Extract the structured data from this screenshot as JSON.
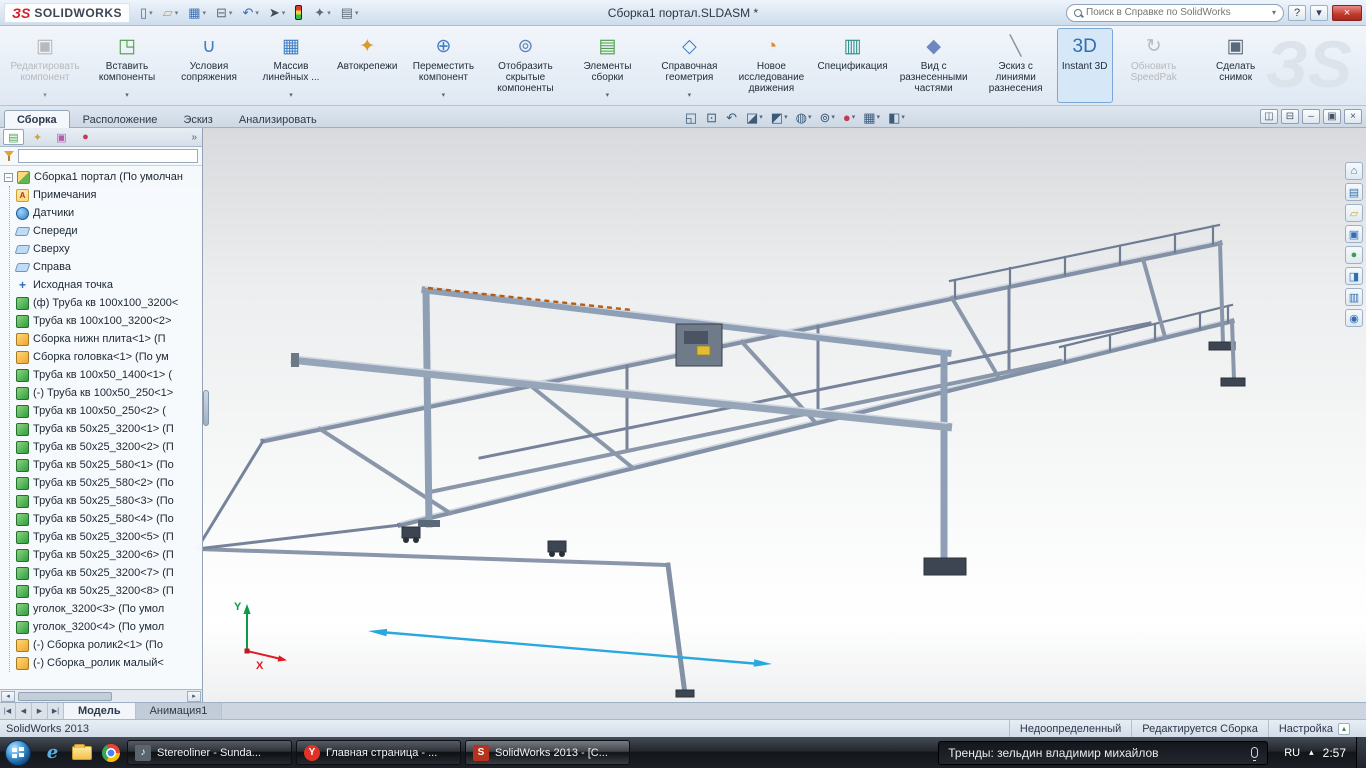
{
  "titlebar": {
    "logo_mark": "ЗS",
    "logo_text": "SOLIDWORKS",
    "title": "Сборка1 портал.SLDASM *",
    "search": {
      "placeholder": "Поиск в Справке по SolidWorks",
      "arrow": "▾"
    },
    "help": "?",
    "dropdown": "▾",
    "close": "×",
    "menu_icons": [
      {
        "name": "new-file-icon",
        "glyph": "▯",
        "color": "#5b6a7a",
        "arrow": "▾"
      },
      {
        "name": "open-icon",
        "glyph": "▱",
        "color": "#caa53d",
        "arrow": "▾"
      },
      {
        "name": "save-icon",
        "glyph": "▦",
        "color": "#3f6fb0",
        "arrow": "▾"
      },
      {
        "name": "print-icon",
        "glyph": "⊟",
        "color": "#5b6a7a",
        "arrow": "▾"
      },
      {
        "name": "undo-icon",
        "glyph": "↶",
        "color": "#2f6fb2",
        "arrow": "▾"
      },
      {
        "name": "select-icon",
        "glyph": "➤",
        "color": "#444c57",
        "arrow": "▾"
      },
      {
        "name": "rebuild-icon",
        "glyph": "",
        "color": "",
        "cls": "traffic-light",
        "arrow": ""
      },
      {
        "name": "options-icon",
        "glyph": "✦",
        "color": "#5b6a7a",
        "arrow": "▾"
      },
      {
        "name": "file-properties-icon",
        "glyph": "▤",
        "color": "#5b6a7a",
        "arrow": "▾"
      }
    ]
  },
  "ribbon": {
    "watermark": "ЗS",
    "buttons": [
      {
        "name": "edit-component-button",
        "label": "Редактировать компонент",
        "glyph": "▣",
        "color": "#9aa4ae",
        "arrow": "▾",
        "disabled": true
      },
      {
        "name": "insert-components-button",
        "label": "Вставить компоненты",
        "glyph": "◳",
        "color": "#4d9e46",
        "arrow": "▾"
      },
      {
        "name": "mates-button",
        "label": "Условия сопряжения",
        "glyph": "∪",
        "color": "#3f7fc4",
        "arrow": ""
      },
      {
        "name": "linear-pattern-button",
        "label": "Массив линейных ...",
        "glyph": "▦",
        "color": "#3f7fc4",
        "arrow": "▾"
      },
      {
        "name": "smart-fasteners-button",
        "label": "Автокрепежи",
        "glyph": "✦",
        "color": "#d99a2b",
        "arrow": ""
      },
      {
        "name": "move-component-button",
        "label": "Переместить компонент",
        "glyph": "⊕",
        "color": "#3f7fc4",
        "arrow": "▾"
      },
      {
        "name": "show-hidden-components-button",
        "label": "Отобразить скрытые компоненты",
        "glyph": "⊚",
        "color": "#5b86b8",
        "arrow": ""
      },
      {
        "name": "assembly-features-button",
        "label": "Элементы сборки",
        "glyph": "▤",
        "color": "#4d9e46",
        "arrow": "▾"
      },
      {
        "name": "reference-geometry-button",
        "label": "Справочная геометрия",
        "glyph": "◇",
        "color": "#3f7fc4",
        "arrow": "▾"
      },
      {
        "name": "new-motion-study-button",
        "label": "Новое исследование движения",
        "glyph": "◔",
        "color": "#e08a28",
        "arrow": ""
      },
      {
        "name": "bom-button",
        "label": "Спецификация",
        "glyph": "▥",
        "color": "#2e8f8a",
        "arrow": ""
      },
      {
        "name": "exploded-view-button",
        "label": "Вид с разнесенными частями",
        "glyph": "◆",
        "color": "#6d87c0",
        "arrow": ""
      },
      {
        "name": "explode-line-sketch-button",
        "label": "Эскиз с линиями разнесения",
        "glyph": "╲",
        "color": "#8a94a0",
        "arrow": ""
      },
      {
        "name": "instant-3d-button",
        "label": "Instant 3D",
        "glyph": "3D",
        "color": "#2f6fb2",
        "arrow": "",
        "active": true
      },
      {
        "name": "update-speedpak-button",
        "label": "Обновить SpeedPak",
        "glyph": "↻",
        "color": "#9aa4ae",
        "arrow": "",
        "disabled": true
      },
      {
        "name": "take-snapshot-button",
        "label": "Сделать снимок",
        "glyph": "▣",
        "color": "#5b6a7a",
        "arrow": ""
      }
    ],
    "tabs": [
      {
        "label": "Сборка",
        "active": true
      },
      {
        "label": "Расположение",
        "active": false
      },
      {
        "label": "Эскиз",
        "active": false
      },
      {
        "label": "Анализировать",
        "active": false
      }
    ],
    "hud_icons": [
      {
        "name": "zoom-fit-icon",
        "glyph": "◱",
        "color": "#3c5a7a",
        "arrow": ""
      },
      {
        "name": "zoom-area-icon",
        "glyph": "⊡",
        "color": "#3c5a7a",
        "arrow": ""
      },
      {
        "name": "previous-view-icon",
        "glyph": "↶",
        "color": "#3c5a7a",
        "arrow": ""
      },
      {
        "name": "section-view-icon",
        "glyph": "◪",
        "color": "#3c5a7a",
        "arrow": "▾"
      },
      {
        "name": "view-orientation-icon",
        "glyph": "◩",
        "color": "#3c5a7a",
        "arrow": "▾"
      },
      {
        "name": "display-style-icon",
        "glyph": "◍",
        "color": "#3c5a7a",
        "arrow": "▾"
      },
      {
        "name": "hide-show-items-icon",
        "glyph": "⊚",
        "color": "#3c5a7a",
        "arrow": "▾"
      },
      {
        "name": "edit-appearance-icon",
        "glyph": "●",
        "color": "#c23b4e",
        "arrow": "▾"
      },
      {
        "name": "apply-scene-icon",
        "glyph": "▦",
        "color": "#3c5a7a",
        "arrow": "▾"
      },
      {
        "name": "view-settings-icon",
        "glyph": "◧",
        "color": "#3c5a7a",
        "arrow": "▾"
      }
    ],
    "doc_controls": [
      {
        "name": "viewport-pane-icon",
        "glyph": "◫"
      },
      {
        "name": "viewport-split-icon",
        "glyph": "⊟"
      },
      {
        "name": "minimize-doc-icon",
        "glyph": "–"
      },
      {
        "name": "restore-doc-icon",
        "glyph": "▣"
      },
      {
        "name": "close-doc-icon",
        "glyph": "×"
      }
    ]
  },
  "tree": {
    "manager_tabs": [
      {
        "name": "featuremanager-tab",
        "glyph": "▤",
        "color": "#3fa14d",
        "active": true
      },
      {
        "name": "propertymanager-tab",
        "glyph": "✦",
        "color": "#caa53d",
        "active": false
      },
      {
        "name": "configurationmanager-tab",
        "glyph": "▣",
        "color": "#b05fb0",
        "active": false
      },
      {
        "name": "displaymanager-tab",
        "glyph": "●",
        "color": "#c23b4e",
        "active": false
      }
    ],
    "chevron": "»",
    "root_expander": "–",
    "root": "Сборка1 портал (По умолчан",
    "items": [
      {
        "icon": "i-ann",
        "label": "Примечания"
      },
      {
        "icon": "i-sensor",
        "label": "Датчики"
      },
      {
        "icon": "i-plane",
        "label": "Спереди"
      },
      {
        "icon": "i-plane",
        "label": "Сверху"
      },
      {
        "icon": "i-plane",
        "label": "Справа"
      },
      {
        "icon": "i-origin",
        "label": "Исходная точка"
      },
      {
        "icon": "i-part",
        "label": "(ф) Труба кв 100x100_3200<"
      },
      {
        "icon": "i-part",
        "label": "Труба кв 100x100_3200<2>"
      },
      {
        "icon": "i-asm",
        "label": "Сборка нижн плита<1> (П"
      },
      {
        "icon": "i-asm",
        "label": "Сборка головка<1> (По ум"
      },
      {
        "icon": "i-part",
        "label": "Труба кв 100x50_1400<1> ("
      },
      {
        "icon": "i-part",
        "label": "(-) Труба кв 100x50_250<1>"
      },
      {
        "icon": "i-part",
        "label": "Труба кв 100x50_250<2> ("
      },
      {
        "icon": "i-part",
        "label": "Труба кв 50x25_3200<1> (П"
      },
      {
        "icon": "i-part",
        "label": "Труба кв 50x25_3200<2> (П"
      },
      {
        "icon": "i-part",
        "label": "Труба кв 50x25_580<1> (По"
      },
      {
        "icon": "i-part",
        "label": "Труба кв 50x25_580<2> (По"
      },
      {
        "icon": "i-part",
        "label": "Труба кв 50x25_580<3> (По"
      },
      {
        "icon": "i-part",
        "label": "Труба кв 50x25_580<4> (По"
      },
      {
        "icon": "i-part",
        "label": "Труба кв 50x25_3200<5> (П"
      },
      {
        "icon": "i-part",
        "label": "Труба кв 50x25_3200<6> (П"
      },
      {
        "icon": "i-part",
        "label": "Труба кв 50x25_3200<7> (П"
      },
      {
        "icon": "i-part",
        "label": "Труба кв 50x25_3200<8> (П"
      },
      {
        "icon": "i-part",
        "label": "уголок_3200<3> (По умол"
      },
      {
        "icon": "i-part",
        "label": "уголок_3200<4> (По умол"
      },
      {
        "icon": "i-asm",
        "label": "(-) Сборка ролик2<1> (По"
      },
      {
        "icon": "i-asm",
        "label": "(-) Сборка_ролик малый<"
      }
    ],
    "hscroll": {
      "left": "◂",
      "right": "▸"
    }
  },
  "right_toolbar": [
    {
      "name": "resources-home-icon",
      "glyph": "⌂",
      "color": "#2f6fb2"
    },
    {
      "name": "design-library-icon",
      "glyph": "▤",
      "color": "#2f6fb2"
    },
    {
      "name": "file-explorer-icon",
      "glyph": "▱",
      "color": "#caa53d"
    },
    {
      "name": "view-palette-icon",
      "glyph": "▣",
      "color": "#2f6fb2"
    },
    {
      "name": "appearances-icon",
      "glyph": "●",
      "color": "#3fa14d"
    },
    {
      "name": "scenes-icon",
      "glyph": "◨",
      "color": "#2f6fb2"
    },
    {
      "name": "custom-properties-icon",
      "glyph": "▥",
      "color": "#2f6fb2"
    },
    {
      "name": "forum-icon",
      "glyph": "◉",
      "color": "#2f6fb2"
    }
  ],
  "viewport": {
    "triad": {
      "x": "X",
      "y": "Y"
    }
  },
  "bottom": {
    "nav": [
      "|◀",
      "◀",
      "▶",
      "▶|"
    ],
    "tabs": [
      {
        "label": "Модель",
        "active": true
      },
      {
        "label": "Анимация1",
        "active": false
      }
    ]
  },
  "statusbar": {
    "product": "SolidWorks 2013",
    "state": "Недоопределенный",
    "mode": "Редактируется Сборка",
    "config": "Настройка",
    "config_arrow": "▴"
  },
  "taskbar": {
    "apps": [
      {
        "name": "taskbar-app-stereoliner",
        "icon_cls": "ic-st",
        "icon_glyph": "♪",
        "label": "Stereoliner - Sunda...",
        "active": false
      },
      {
        "name": "taskbar-app-browser",
        "icon_cls": "ic-ya",
        "icon_glyph": "Y",
        "label": "Главная страница - ...",
        "active": false
      },
      {
        "name": "taskbar-app-solidworks",
        "icon_cls": "ic-sw",
        "icon_glyph": "S",
        "label": "SolidWorks 2013 - [С...",
        "active": true
      }
    ],
    "search": {
      "text": "Тренды: зельдин владимир михайлов"
    },
    "tray": {
      "lang": "RU",
      "expand": "▴",
      "time": "2:57"
    }
  }
}
